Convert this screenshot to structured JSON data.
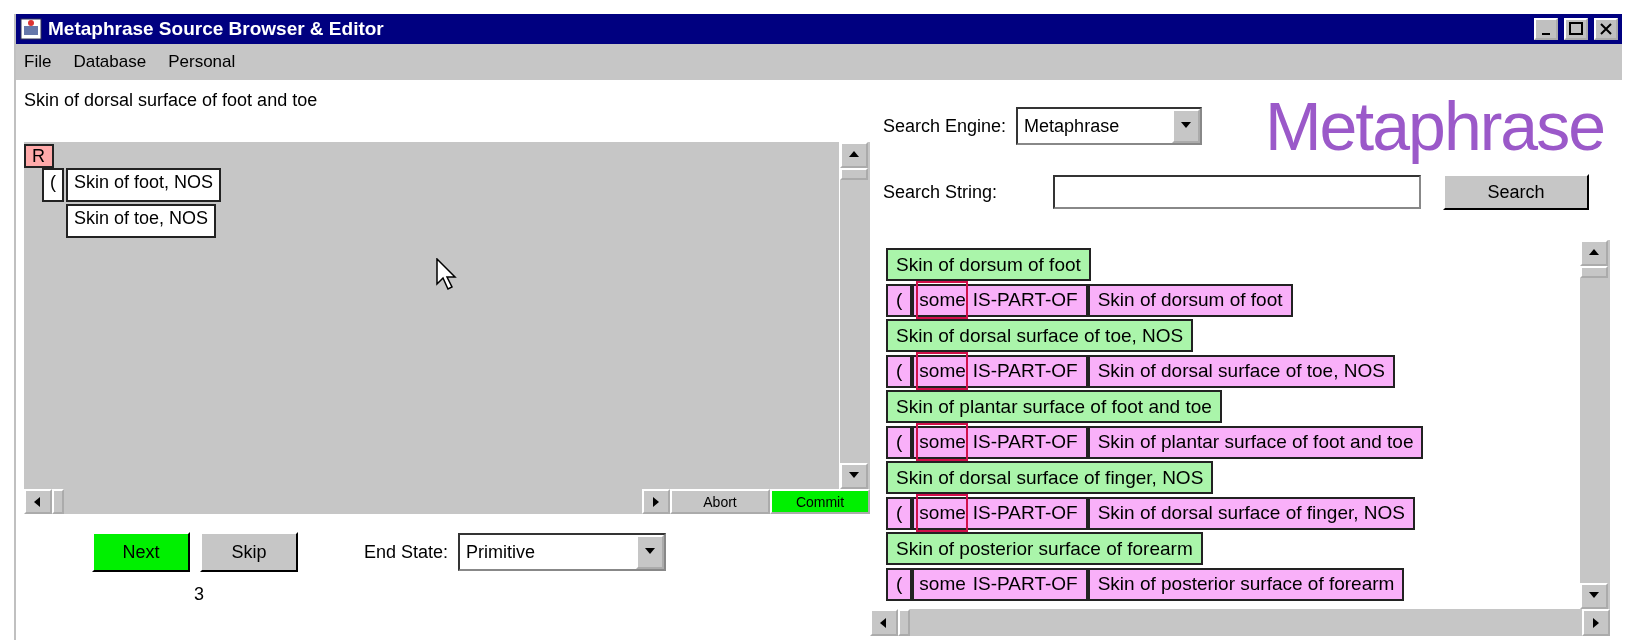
{
  "window": {
    "title": "Metaphrase Source Browser & Editor"
  },
  "menu": [
    "File",
    "Database",
    "Personal"
  ],
  "concept_heading": "Skin of dorsal surface of foot and toe",
  "canvas": {
    "root": "R",
    "paren": "(",
    "children": [
      "Skin of foot, NOS",
      "Skin of toe, NOS"
    ]
  },
  "canvas_buttons": [
    {
      "label": "Abort",
      "kind": "plain"
    },
    {
      "label": "Commit",
      "kind": "go"
    }
  ],
  "actions": [
    {
      "label": "Next",
      "kind": "go"
    },
    {
      "label": "Skip",
      "kind": "plain"
    }
  ],
  "end_state": {
    "label": "End State:",
    "value": "Primitive"
  },
  "count": "3",
  "search_engine": {
    "label": "Search Engine:",
    "value": "Metaphrase"
  },
  "logo": "Metaphrase",
  "search_string": {
    "label": "Search String:"
  },
  "search_button": "Search",
  "results": [
    {
      "kind": "concept",
      "text": "Skin of dorsum of foot"
    },
    {
      "kind": "relation",
      "paren": "(",
      "quantifier": "some",
      "relation": "IS-PART-OF",
      "target": "Skin of dorsum of foot",
      "highlighted": true
    },
    {
      "kind": "concept",
      "text": "Skin of dorsal surface of toe, NOS"
    },
    {
      "kind": "relation",
      "paren": "(",
      "quantifier": "some",
      "relation": "IS-PART-OF",
      "target": "Skin of dorsal surface of toe, NOS",
      "highlighted": true
    },
    {
      "kind": "concept",
      "text": "Skin of plantar surface of foot and toe"
    },
    {
      "kind": "relation",
      "paren": "(",
      "quantifier": "some",
      "relation": "IS-PART-OF",
      "target": "Skin of plantar surface of foot and toe",
      "highlighted": true
    },
    {
      "kind": "concept",
      "text": "Skin of dorsal surface of finger, NOS"
    },
    {
      "kind": "relation",
      "paren": "(",
      "quantifier": "some",
      "relation": "IS-PART-OF",
      "target": "Skin of dorsal surface of finger, NOS",
      "highlighted": true
    },
    {
      "kind": "concept",
      "text": "Skin of posterior surface of forearm"
    },
    {
      "kind": "relation",
      "paren": "(",
      "quantifier": "some",
      "relation": "IS-PART-OF",
      "target": "Skin of posterior surface of forearm",
      "highlighted": false
    }
  ]
}
